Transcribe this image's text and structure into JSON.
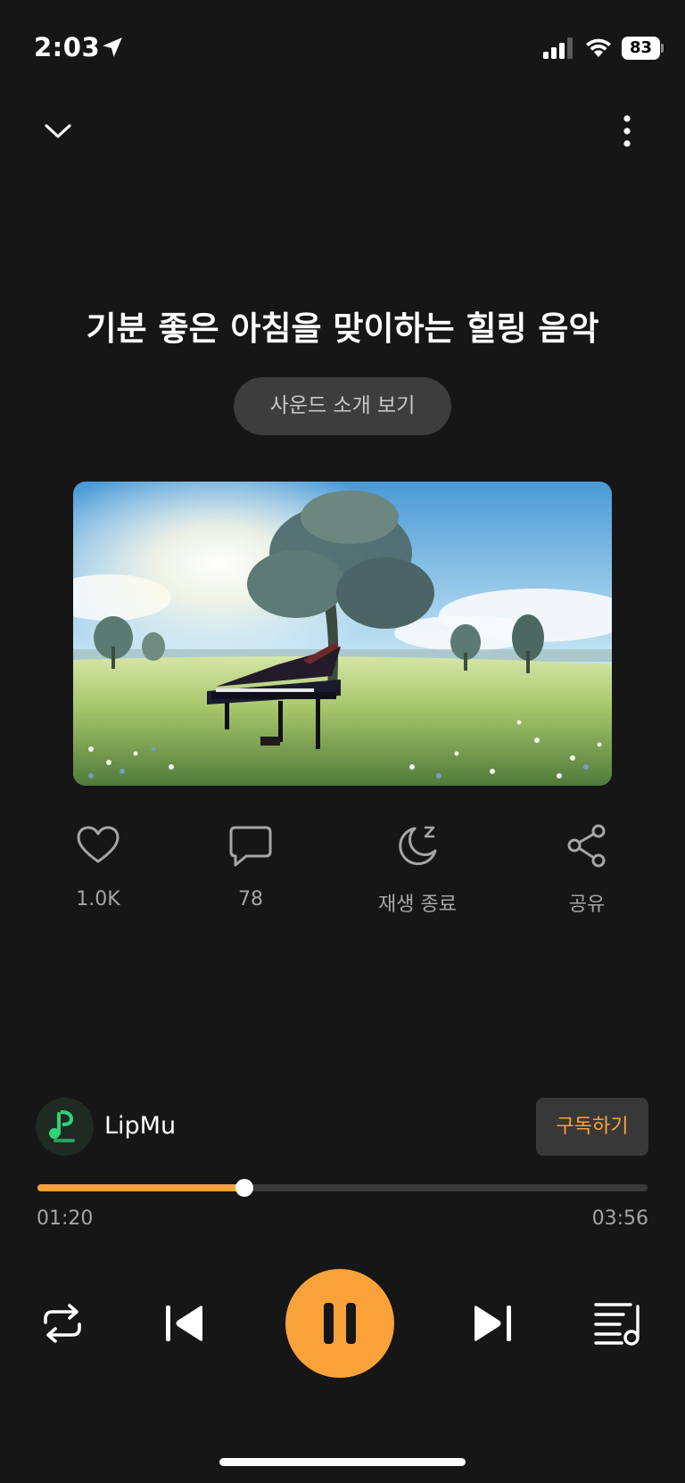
{
  "status_bar": {
    "time": "2:03",
    "battery": "83"
  },
  "header": {
    "collapse_icon": "chevron-down-icon",
    "more_icon": "more-vertical-icon"
  },
  "track": {
    "title": "기분 좋은 아침을 맞이하는 힐링 음악",
    "intro_button": "사운드 소개 보기"
  },
  "actions": [
    {
      "icon": "heart-icon",
      "label": "1.0K"
    },
    {
      "icon": "comment-icon",
      "label": "78"
    },
    {
      "icon": "sleep-timer-icon",
      "label": "재생 종료"
    },
    {
      "icon": "share-icon",
      "label": "공유"
    }
  ],
  "artist": {
    "name": "LipMu",
    "subscribe_label": "구독하기"
  },
  "progress": {
    "current": "01:20",
    "total": "03:56",
    "fraction": 0.339
  },
  "controls": {
    "repeat_icon": "repeat-icon",
    "prev_icon": "skip-previous-icon",
    "play_state_icon": "pause-icon",
    "next_icon": "skip-next-icon",
    "queue_icon": "playlist-icon"
  },
  "colors": {
    "background": "#161616",
    "accent": "#f9a23a",
    "muted_text": "#a6a6a6"
  }
}
